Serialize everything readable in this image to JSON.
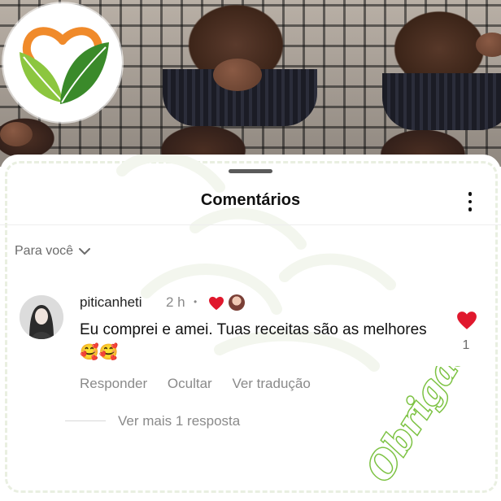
{
  "sheet": {
    "title": "Comentários",
    "filter_label": "Para você"
  },
  "comment": {
    "username": "piticanheti",
    "time": "2 h",
    "text": "Eu comprei e amei. Tuas receitas são as melhores 🥰🥰",
    "actions": {
      "reply": "Responder",
      "hide": "Ocultar",
      "translate": "Ver tradução"
    },
    "like_count": "1",
    "view_replies": "Ver mais 1 resposta",
    "liked_by_creator": true
  },
  "overlay": {
    "signature": "Obrigada!"
  },
  "colors": {
    "like_red": "#e0182d",
    "brand_orange": "#f08a2a",
    "brand_green": "#4f9a2e",
    "signature_green": "#7cc242"
  },
  "icons": {
    "more": "vertical-ellipsis",
    "filter_dropdown": "chevron-down",
    "like": "heart-filled"
  }
}
